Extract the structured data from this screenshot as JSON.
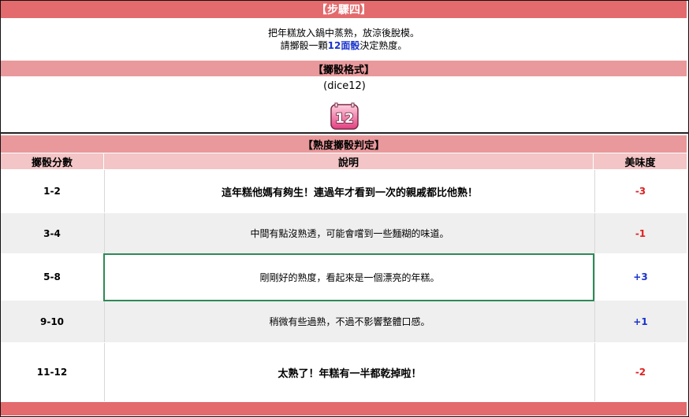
{
  "step": {
    "title": "【步驟四】",
    "line1": "把年糕放入鍋中蒸熟，放涼後脫模。",
    "line2_pre": "請擲骰一顆",
    "line2_highlight": "12面骰",
    "line2_post": "決定熟度。"
  },
  "dice_format": {
    "title": "【擲骰格式】",
    "command": "(dice12)",
    "icon_label": "12"
  },
  "judgement": {
    "title": "【熟度擲骰判定】",
    "headers": [
      "擲骰分數",
      "說明",
      "美味度"
    ],
    "rows": [
      {
        "range": "1-2",
        "desc": "這年糕他媽有夠生！連過年才看到一次的親戚都比他熟！",
        "score": "-3"
      },
      {
        "range": "3-4",
        "desc": "中間有點沒熟透，可能會嚐到一些麵糊的味道。",
        "score": "-1"
      },
      {
        "range": "5-8",
        "desc": "剛剛好的熟度，看起來是一個漂亮的年糕。",
        "score": "+3"
      },
      {
        "range": "9-10",
        "desc": "稍微有些過熟，不過不影響整體口感。",
        "score": "+1"
      },
      {
        "range": "11-12",
        "desc": "太熟了！年糕有一半都乾掉啦！",
        "score": "-2"
      }
    ]
  },
  "colors": {
    "title_bar": "#e36b6d",
    "section_bar": "#e9999c",
    "header_bar": "#f3c5c6",
    "negative": "#e02020",
    "positive": "#1a33cc",
    "highlight_border": "#2e8a57"
  }
}
